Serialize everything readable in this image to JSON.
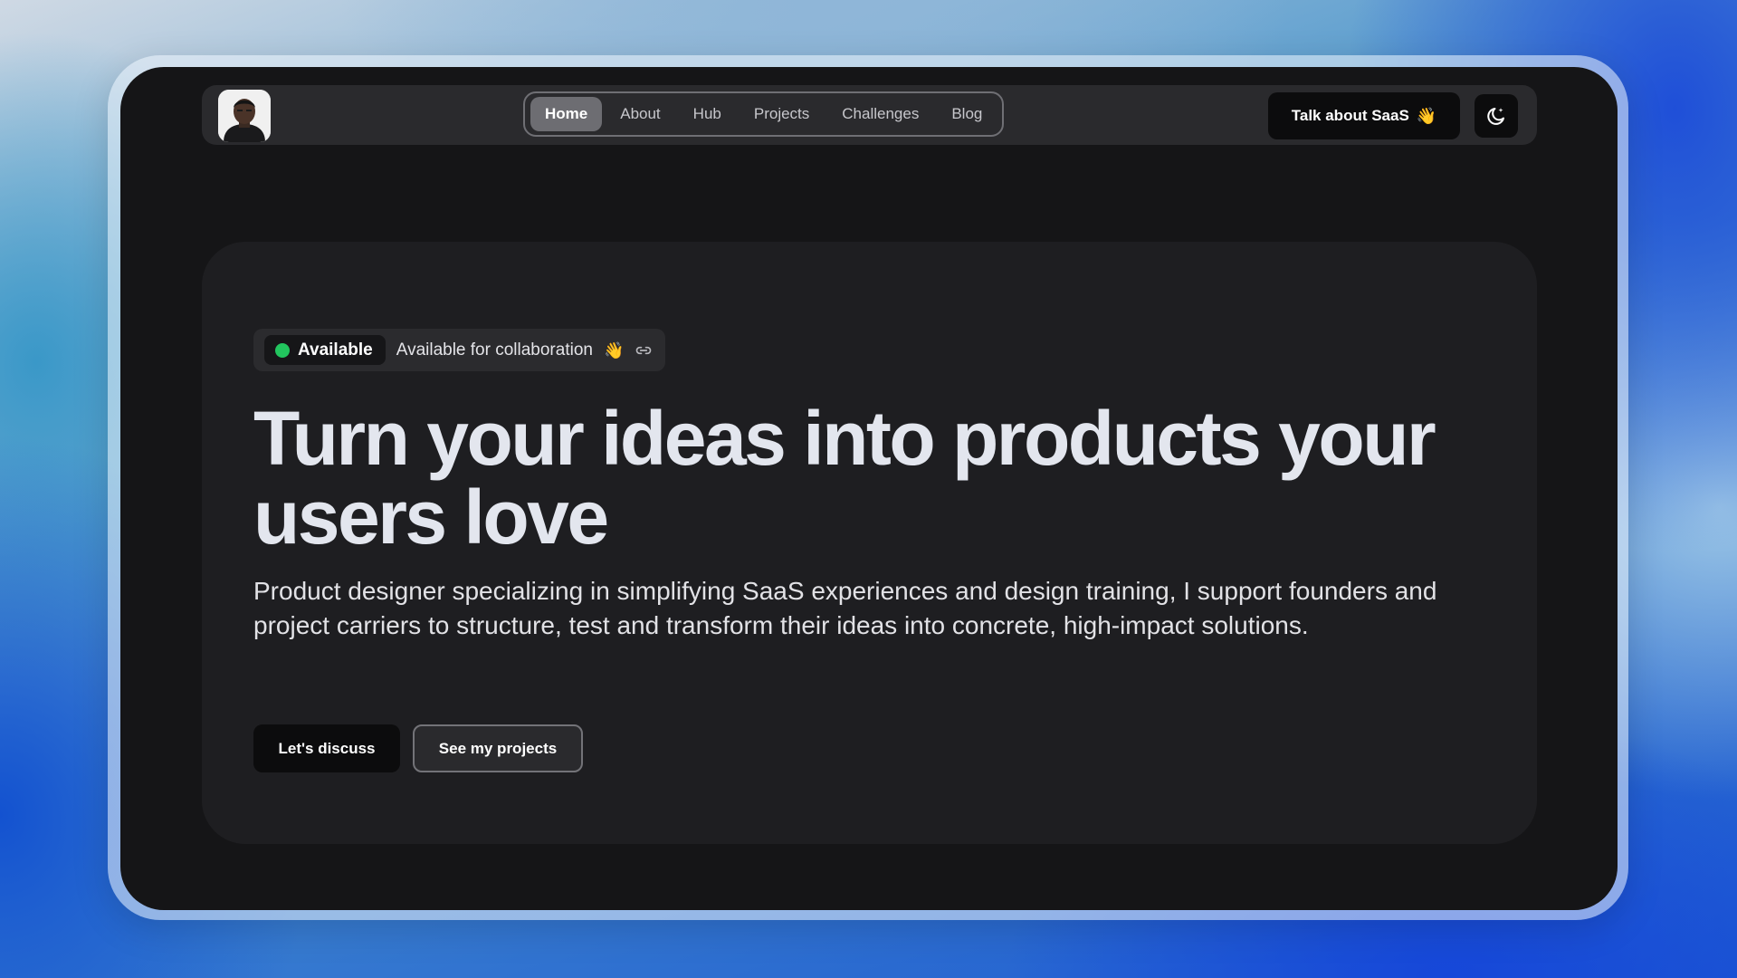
{
  "nav": {
    "avatar_alt": "profile photo",
    "items": [
      {
        "label": "Home",
        "active": true
      },
      {
        "label": "About",
        "active": false
      },
      {
        "label": "Hub",
        "active": false
      },
      {
        "label": "Projects",
        "active": false
      },
      {
        "label": "Challenges",
        "active": false
      },
      {
        "label": "Blog",
        "active": false
      }
    ],
    "cta_label": "Talk about SaaS",
    "cta_icon": "waving-hand-icon",
    "theme_icon": "moon-icon"
  },
  "hero": {
    "badge": {
      "status_label": "Available",
      "status_color": "#22c55e",
      "text": "Available for collaboration",
      "icons": [
        "waving-hand-icon",
        "link-icon"
      ]
    },
    "headline": "Turn your ideas into products your users love",
    "subtitle": "Product designer specializing in simplifying SaaS experiences and design training, I support founders and project carriers to structure, test and transform their ideas into concrete, high-impact solutions.",
    "primary_button": "Let's discuss",
    "secondary_button": "See my projects"
  },
  "colors": {
    "page_background": "#151517",
    "card_background": "#1e1e21",
    "accent_green": "#22c55e"
  }
}
